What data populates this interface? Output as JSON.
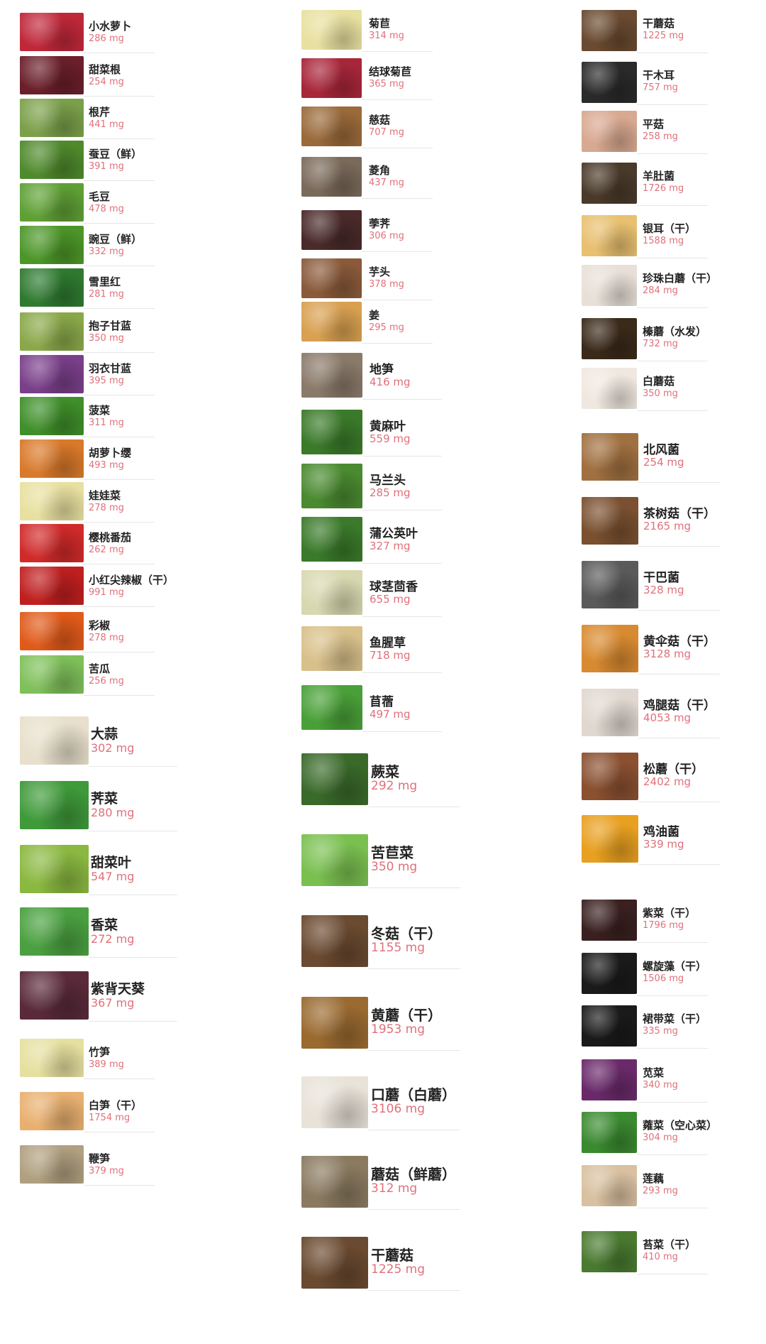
{
  "colors": {
    "value_text": "#e0707a",
    "name_text": "#222222",
    "separator": "#e6e6e6"
  },
  "columns": [
    {
      "items": [
        {
          "name": "小水萝卜",
          "value": "286 mg",
          "img": "radish-photo",
          "color": "#c0283a"
        },
        {
          "name": "甜菜根",
          "value": "254 mg",
          "img": "beetroot-photo",
          "color": "#6b1f2a"
        },
        {
          "name": "根芹",
          "value": "441 mg",
          "img": "celeriac-photo",
          "color": "#7ba04a"
        },
        {
          "name": "蚕豆（鲜）",
          "value": "391 mg",
          "img": "broad-bean-photo",
          "color": "#4f8a2c"
        },
        {
          "name": "毛豆",
          "value": "478 mg",
          "img": "edamame-photo",
          "color": "#5fa035"
        },
        {
          "name": "豌豆（鲜）",
          "value": "332 mg",
          "img": "pea-photo",
          "color": "#4c9628"
        },
        {
          "name": "雪里红",
          "value": "281 mg",
          "img": "mustard-greens-photo",
          "color": "#2f7a30"
        },
        {
          "name": "抱子甘蓝",
          "value": "350 mg",
          "img": "brussels-sprouts-photo",
          "color": "#8aa84a"
        },
        {
          "name": "羽衣甘蓝",
          "value": "395 mg",
          "img": "kale-photo",
          "color": "#7a3f8a"
        },
        {
          "name": "菠菜",
          "value": "311 mg",
          "img": "spinach-photo",
          "color": "#3f8f2a"
        },
        {
          "name": "胡萝卜缨",
          "value": "493 mg",
          "img": "carrot-greens-photo",
          "color": "#d9792a"
        },
        {
          "name": "娃娃菜",
          "value": "278 mg",
          "img": "baby-cabbage-photo",
          "color": "#e8e0a0"
        },
        {
          "name": "樱桃番茄",
          "value": "262 mg",
          "img": "cherry-tomato-photo",
          "color": "#d02a2a"
        },
        {
          "name": "小红尖辣椒（干）",
          "value": "991 mg",
          "img": "dried-chili-photo",
          "color": "#c01f1f"
        },
        {
          "name": "彩椒",
          "value": "278 mg",
          "img": "bell-pepper-photo",
          "color": "#e05a1a"
        },
        {
          "name": "苦瓜",
          "value": "256 mg",
          "img": "bitter-melon-photo",
          "color": "#7fc05a"
        },
        {
          "name": "大蒜",
          "value": "302 mg",
          "img": "garlic-photo",
          "color": "#e8e0cc"
        },
        {
          "name": "荠菜",
          "value": "280 mg",
          "img": "shepherds-purse-photo",
          "color": "#3f9a3a"
        },
        {
          "name": "甜菜叶",
          "value": "547 mg",
          "img": "beet-leaf-photo",
          "color": "#8ab840"
        },
        {
          "name": "香菜",
          "value": "272 mg",
          "img": "coriander-photo",
          "color": "#4aa040"
        },
        {
          "name": "紫背天葵",
          "value": "367 mg",
          "img": "begonia-greens-photo",
          "color": "#5a2a3a"
        },
        {
          "name": "竹笋",
          "value": "389 mg",
          "img": "bamboo-shoot-photo",
          "color": "#e6e0a0"
        },
        {
          "name": "白笋（干）",
          "value": "1754 mg",
          "img": "dried-bamboo-photo",
          "color": "#e8b070"
        },
        {
          "name": "鞭笋",
          "value": "379 mg",
          "img": "whip-shoot-photo",
          "color": "#b0a080"
        }
      ]
    },
    {
      "items": [
        {
          "name": "菊苣",
          "value": "314 mg",
          "img": "endive-photo",
          "color": "#e8e0a0"
        },
        {
          "name": "结球菊苣",
          "value": "365 mg",
          "img": "radicchio-photo",
          "color": "#a8263a"
        },
        {
          "name": "慈菇",
          "value": "707 mg",
          "img": "arrowhead-photo",
          "color": "#9a6a3a"
        },
        {
          "name": "菱角",
          "value": "437 mg",
          "img": "water-caltrop-photo",
          "color": "#7a6a5a"
        },
        {
          "name": "荸荠",
          "value": "306 mg",
          "img": "water-chestnut-photo",
          "color": "#4a2a2a"
        },
        {
          "name": "芋头",
          "value": "378 mg",
          "img": "taro-photo",
          "color": "#8a5a3a"
        },
        {
          "name": "姜",
          "value": "295 mg",
          "img": "ginger-photo",
          "color": "#d8a050"
        },
        {
          "name": "地笋",
          "value": "416 mg",
          "img": "lycopus-root-photo",
          "color": "#8a7a6a"
        },
        {
          "name": "黄麻叶",
          "value": "559 mg",
          "img": "jute-leaf-photo",
          "color": "#3a7a2a"
        },
        {
          "name": "马兰头",
          "value": "285 mg",
          "img": "kalimeris-photo",
          "color": "#4a8a30"
        },
        {
          "name": "蒲公英叶",
          "value": "327 mg",
          "img": "dandelion-photo",
          "color": "#3a7a2a"
        },
        {
          "name": "球茎茴香",
          "value": "655 mg",
          "img": "fennel-photo",
          "color": "#d8d8b0"
        },
        {
          "name": "鱼腥草",
          "value": "718 mg",
          "img": "houttuynia-photo",
          "color": "#d8c08a"
        },
        {
          "name": "苜蓿",
          "value": "497 mg",
          "img": "alfalfa-photo",
          "color": "#4aa038"
        },
        {
          "name": "蕨菜",
          "value": "292 mg",
          "img": "fern-photo",
          "color": "#3a6a2a"
        },
        {
          "name": "苦苣菜",
          "value": "350 mg",
          "img": "sow-thistle-photo",
          "color": "#7ac050"
        },
        {
          "name": "冬菇（干）",
          "value": "1155 mg",
          "img": "dried-shiitake-photo",
          "color": "#6a4a30"
        },
        {
          "name": "黄蘑（干）",
          "value": "1953 mg",
          "img": "dried-yellow-mushroom-photo",
          "color": "#9a6a30"
        },
        {
          "name": "口蘑（白蘑）",
          "value": "3106 mg",
          "img": "button-mushroom-photo",
          "color": "#e8e2d8"
        },
        {
          "name": "蘑菇（鲜蘑）",
          "value": "312 mg",
          "img": "fresh-mushroom-photo",
          "color": "#8a7a60"
        },
        {
          "name": "干蘑菇",
          "value": "1225 mg",
          "img": "dried-mushroom-photo",
          "color": "#6a4a30"
        }
      ]
    },
    {
      "items": [
        {
          "name": "干蘑菇",
          "value": "1225 mg",
          "img": "dried-mushroom-photo",
          "color": "#6a4a30"
        },
        {
          "name": "干木耳",
          "value": "757 mg",
          "img": "dried-wood-ear-photo",
          "color": "#2a2a2a"
        },
        {
          "name": "平菇",
          "value": "258 mg",
          "img": "oyster-mushroom-photo",
          "color": "#d8a890"
        },
        {
          "name": "羊肚菌",
          "value": "1726 mg",
          "img": "morel-photo",
          "color": "#4a3a2a"
        },
        {
          "name": "银耳（干）",
          "value": "1588 mg",
          "img": "white-fungus-photo",
          "color": "#e8c070"
        },
        {
          "name": "珍珠白蘑（干）",
          "value": "284 mg",
          "img": "pearl-mushroom-photo",
          "color": "#e8e0d8"
        },
        {
          "name": "榛蘑（水发）",
          "value": "732 mg",
          "img": "hazel-mushroom-photo",
          "color": "#3a2a1a"
        },
        {
          "name": "白蘑菇",
          "value": "350 mg",
          "img": "white-mushroom-photo",
          "color": "#f0e8e0"
        },
        {
          "name": "北风菌",
          "value": "254 mg",
          "img": "north-wind-fungus-photo",
          "color": "#a07040"
        },
        {
          "name": "茶树菇（干）",
          "value": "2165 mg",
          "img": "tea-tree-mushroom-photo",
          "color": "#7a5030"
        },
        {
          "name": "干巴菌",
          "value": "328 mg",
          "img": "ganba-fungus-photo",
          "color": "#5a5a5a"
        },
        {
          "name": "黄伞菇（干）",
          "value": "3128 mg",
          "img": "pholiota-photo",
          "color": "#d88a30"
        },
        {
          "name": "鸡腿菇（干）",
          "value": "4053 mg",
          "img": "shaggy-mane-photo",
          "color": "#e0d8d0"
        },
        {
          "name": "松蘑（干）",
          "value": "2402 mg",
          "img": "pine-mushroom-photo",
          "color": "#8a5030"
        },
        {
          "name": "鸡油菌",
          "value": "339 mg",
          "img": "chanterelle-photo",
          "color": "#e8a020"
        },
        {
          "name": "紫菜（干）",
          "value": "1796 mg",
          "img": "laver-photo",
          "color": "#3a2020"
        },
        {
          "name": "螺旋藻（干）",
          "value": "1506 mg",
          "img": "spirulina-photo",
          "color": "#1a1a1a"
        },
        {
          "name": "裙带菜（干）",
          "value": "335 mg",
          "img": "wakame-photo",
          "color": "#1a1a1a"
        },
        {
          "name": "苋菜",
          "value": "340 mg",
          "img": "amaranth-photo",
          "color": "#6a2a6a"
        },
        {
          "name": "蕹菜（空心菜）",
          "value": "304 mg",
          "img": "water-spinach-photo",
          "color": "#3a8a30"
        },
        {
          "name": "莲藕",
          "value": "293 mg",
          "img": "lotus-root-photo",
          "color": "#d8c0a0"
        },
        {
          "name": "苔菜（干）",
          "value": "410 mg",
          "img": "dried-moss-greens-photo",
          "color": "#4a7a30"
        }
      ]
    }
  ]
}
